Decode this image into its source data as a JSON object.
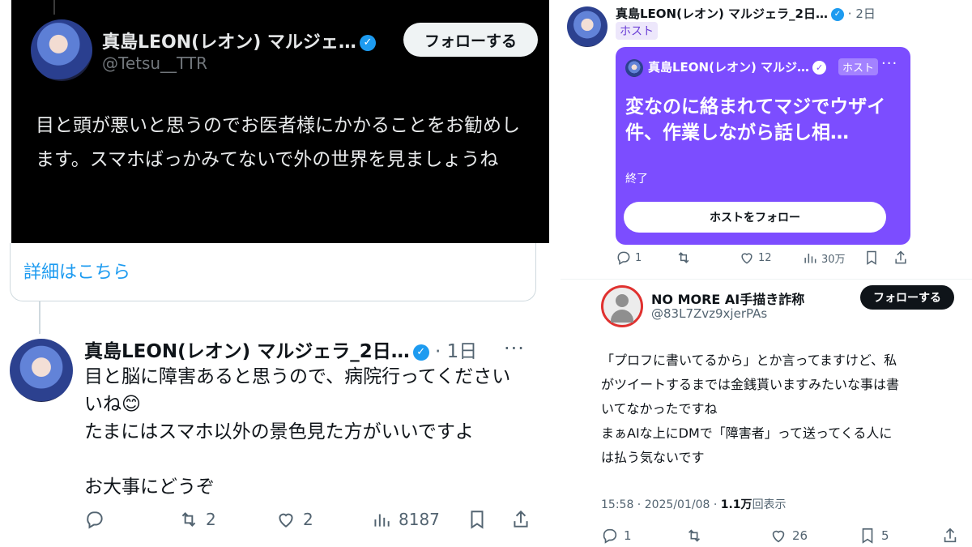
{
  "quoted": {
    "name": "真島LEON(レオン) マルジェ…",
    "handle": "@Tetsu__TTR",
    "follow_label": "フォローする",
    "body": "目と頭が悪いと思うのでお医者様にかかることをお勧めします。スマホばっかみてないで外の世界を見ましょうね",
    "more_link": "詳細はこちら"
  },
  "reply": {
    "name": "真島LEON(レオン) マルジェラ_2日…",
    "time": "1日",
    "more": "···",
    "line1": "目と脳に障害あると思うので、病院行ってください",
    "line2": "いね😊",
    "line3": "たまにはスマホ以外の景色見た方がいいですよ",
    "line4": "お大事にどうぞ",
    "retweets": "2",
    "likes": "2",
    "views": "8187"
  },
  "space_post": {
    "name": "真島LEON(レオン) マルジェラ_2日…",
    "time": "2日",
    "host_badge": "ホスト",
    "card_name": "真島LEON(レオン) マルジ…",
    "card_host": "ホスト",
    "card_more": "···",
    "card_title": "変なのに絡まれてマジでウザイ件、作業しながら話し相…",
    "card_status": "終了",
    "card_follow_label": "ホストをフォロー",
    "replies": "1",
    "likes": "12",
    "views": "30万",
    "accent_color": "#7c4dff"
  },
  "nomore": {
    "name": "NO MORE AI手描き詐称",
    "handle": "@83L7Zvz9xjerPAs",
    "follow_label": "フォローする",
    "line1": "「プロフに書いてるから」とか言ってますけど、私",
    "line2": "がツイートするまでは金銭貰いますみたいな事は書",
    "line3": "いてなかったですね",
    "line4": "まぁAIな上にDMで「障害者」って送ってくる人に",
    "line5": "は払う気ないです",
    "timestamp": "15:58 · 2025/01/08 · ",
    "views_count": "1.1万",
    "views_label": "回表示",
    "replies": "1",
    "likes": "26",
    "bookmarks": "5"
  }
}
